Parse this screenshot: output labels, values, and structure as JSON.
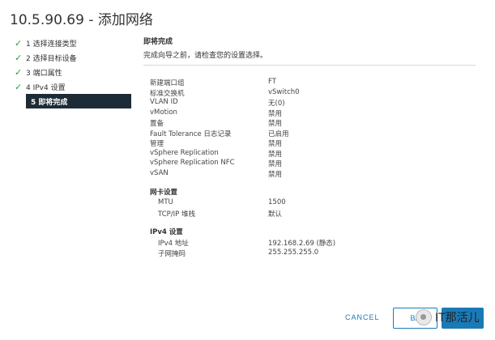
{
  "header": {
    "title": "10.5.90.69 - 添加网络"
  },
  "steps": [
    {
      "label": "1 选择连接类型",
      "done": true
    },
    {
      "label": "2 选择目标设备",
      "done": true
    },
    {
      "label": "3 端口属性",
      "done": true
    },
    {
      "label": "4 IPv4 设置",
      "done": true
    },
    {
      "label": "5 即将完成",
      "done": false,
      "active": true
    }
  ],
  "main": {
    "section_title": "即将完成",
    "section_desc": "完成向导之前，请检查您的设置选择。",
    "summary": [
      {
        "k": "新建端口组",
        "v": "FT"
      },
      {
        "k": "标准交换机",
        "v": "vSwitch0"
      },
      {
        "k": "VLAN ID",
        "v": "无(0)"
      },
      {
        "k": "vMotion",
        "v": "禁用"
      },
      {
        "k": "置备",
        "v": "禁用"
      },
      {
        "k": "Fault Tolerance 日志记录",
        "v": "已启用"
      },
      {
        "k": "管理",
        "v": "禁用"
      },
      {
        "k": "vSphere Replication",
        "v": "禁用"
      },
      {
        "k": "vSphere Replication NFC",
        "v": "禁用"
      },
      {
        "k": "vSAN",
        "v": "禁用"
      }
    ],
    "nic_title": "网卡设置",
    "nic": [
      {
        "k": "MTU",
        "v": "1500"
      },
      {
        "k": "TCP/IP 堆栈",
        "v": "默认"
      }
    ],
    "ipv4_title": "IPv4 设置",
    "ipv4": [
      {
        "k": "IPv4 地址",
        "v": "192.168.2.69 (静态)"
      },
      {
        "k": "子网掩码",
        "v": "255.255.255.0"
      }
    ]
  },
  "footer": {
    "cancel_label": "CANCEL",
    "back_label": "BA",
    "finish_label": "",
    "watermark": "IT那活儿"
  }
}
